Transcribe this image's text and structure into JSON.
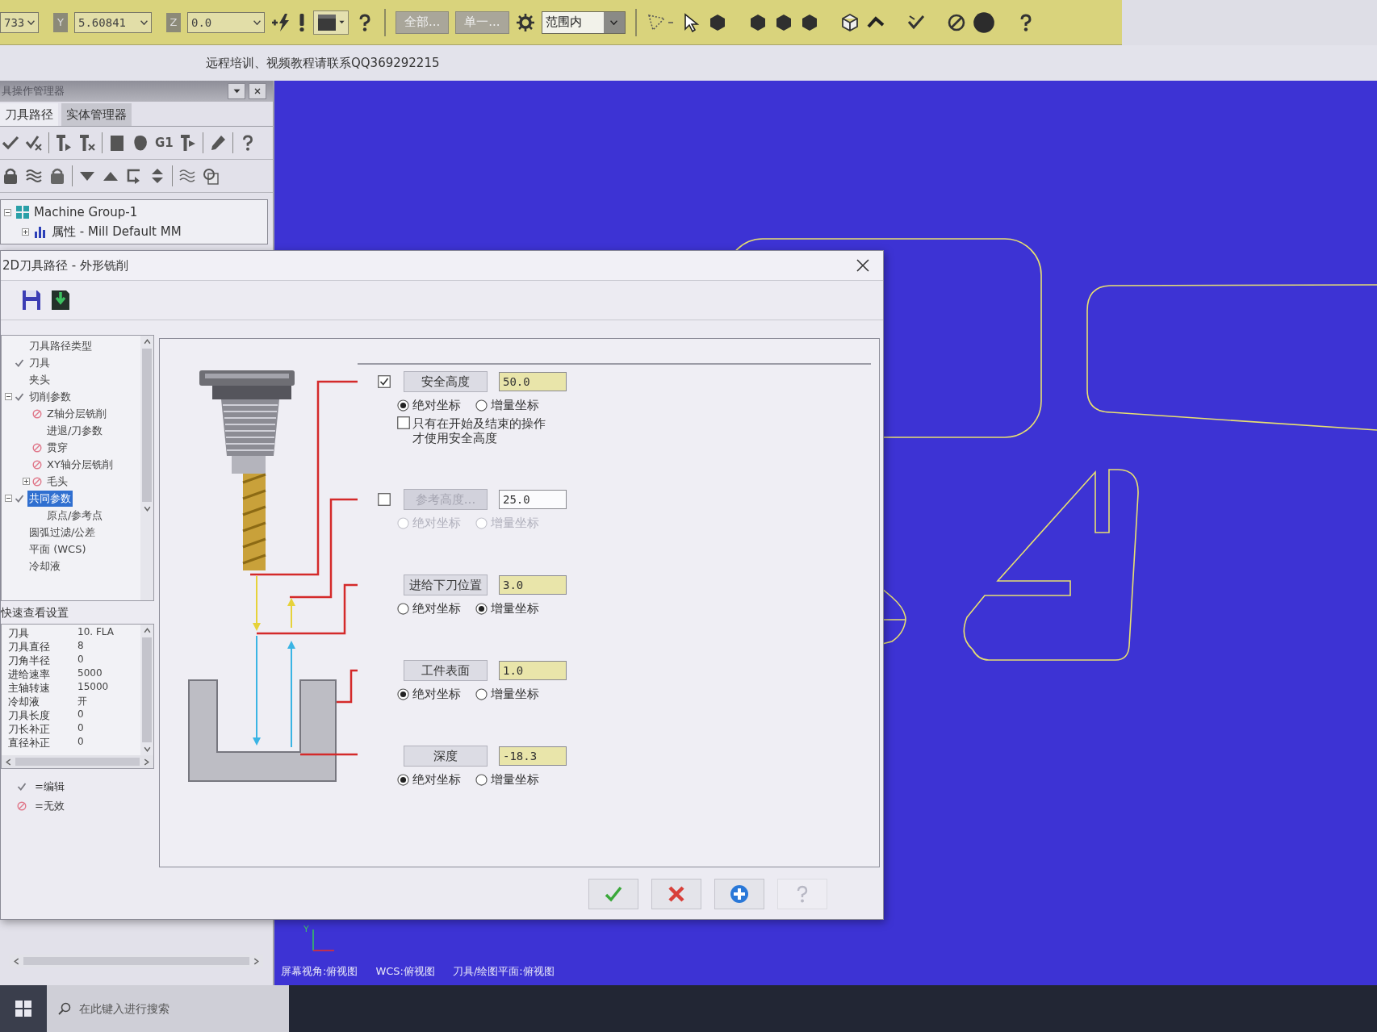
{
  "toolbar": {
    "coord_fields": [
      {
        "value": "733"
      },
      {
        "label": "Y",
        "value": "5.60841"
      },
      {
        "label": "Z",
        "value": "0.0"
      }
    ],
    "select_buttons": [
      "全部...",
      "单一..."
    ],
    "range_dropdown": {
      "value": "范围内"
    }
  },
  "banner": "远程培训、视频教程请联系QQ369292215",
  "manager_panel": {
    "title": "具操作管理器",
    "tabs": [
      {
        "label": "刀具路径",
        "selected": true
      },
      {
        "label": "实体管理器",
        "selected": false
      }
    ],
    "toolbar_text_button": "G1",
    "tree": [
      {
        "kind": "machine_group",
        "label": "Machine Group-1",
        "expanded": true,
        "children": [
          {
            "kind": "properties",
            "label": "属性 - Mill Default MM",
            "expanded": false
          }
        ]
      }
    ]
  },
  "dialog": {
    "title": "2D刀具路径 - 外形铣削",
    "pages": [
      {
        "kind": "plain",
        "label": "刀具路径类型",
        "selected": false
      },
      {
        "kind": "edited",
        "label": "刀具",
        "selected": false
      },
      {
        "kind": "plain",
        "label": "夹头",
        "selected": false
      },
      {
        "kind": "edited",
        "label": "切削参数",
        "expanded": true,
        "selected": false,
        "children": [
          {
            "kind": "invalid",
            "label": "Z轴分层铣削",
            "selected": false
          },
          {
            "kind": "plain",
            "label": "进退/刀参数",
            "selected": false
          },
          {
            "kind": "invalid",
            "label": "贯穿",
            "selected": false
          },
          {
            "kind": "invalid",
            "label": "XY轴分层铣削",
            "selected": false
          },
          {
            "kind": "invalid",
            "label": "毛头",
            "expanded": false,
            "selected": false
          }
        ]
      },
      {
        "kind": "edited",
        "label": "共同参数",
        "expanded": true,
        "selected": true,
        "children": [
          {
            "kind": "plain",
            "label": "原点/参考点",
            "selected": false
          }
        ]
      },
      {
        "kind": "plain",
        "label": "圆弧过滤/公差",
        "selected": false
      },
      {
        "kind": "plain",
        "label": "平面 (WCS)",
        "selected": false
      },
      {
        "kind": "plain",
        "label": "冷却液",
        "selected": false
      }
    ],
    "quick_view": {
      "title": "快速查看设置",
      "rows": [
        {
          "name": "刀具",
          "value": "10. FLA"
        },
        {
          "name": "刀具直径",
          "value": "8"
        },
        {
          "name": "刀角半径",
          "value": "0"
        },
        {
          "name": "进给速率",
          "value": "5000"
        },
        {
          "name": "主轴转速",
          "value": "15000"
        },
        {
          "name": "冷却液",
          "value": "开"
        },
        {
          "name": "刀具长度",
          "value": "0"
        },
        {
          "name": "刀长补正",
          "value": "0"
        },
        {
          "name": "直径补正",
          "value": "0"
        }
      ]
    },
    "legend": [
      {
        "kind": "edited",
        "label": "=编辑"
      },
      {
        "kind": "invalid",
        "label": "=无效"
      }
    ],
    "heights": [
      {
        "label": "安全高度",
        "checked": true,
        "disabled": false,
        "value": "50.0",
        "radios": [
          {
            "label": "绝对坐标",
            "selected": true
          },
          {
            "label": "增量坐标",
            "selected": false
          }
        ],
        "option": {
          "label": "只有在开始及结束的操作才使用安全高度",
          "checked": false
        }
      },
      {
        "label": "参考高度...",
        "checked": false,
        "disabled": true,
        "value": "25.0",
        "radios": [
          {
            "label": "绝对坐标",
            "selected": false
          },
          {
            "label": "增量坐标",
            "selected": false
          }
        ]
      },
      {
        "label": "进给下刀位置",
        "disabled": false,
        "value": "3.0",
        "radios": [
          {
            "label": "绝对坐标",
            "selected": false
          },
          {
            "label": "增量坐标",
            "selected": true
          }
        ]
      },
      {
        "label": "工件表面",
        "disabled": false,
        "value": "1.0",
        "radios": [
          {
            "label": "绝对坐标",
            "selected": true
          },
          {
            "label": "增量坐标",
            "selected": false
          }
        ]
      },
      {
        "label": "深度",
        "disabled": false,
        "value": "-18.3",
        "radios": [
          {
            "label": "绝对坐标",
            "selected": true
          },
          {
            "label": "增量坐标",
            "selected": false
          }
        ]
      }
    ],
    "buttons": [
      {
        "kind": "ok",
        "disabled": false
      },
      {
        "kind": "cancel",
        "disabled": false
      },
      {
        "kind": "add",
        "disabled": false
      },
      {
        "kind": "help",
        "disabled": true
      }
    ]
  },
  "viewport": {
    "axis_label": "Y",
    "view_labels": [
      "屏幕视角:俯视图",
      "WCS:俯视图",
      "刀具/绘图平面:俯视图"
    ]
  },
  "taskbar": {
    "search": {
      "placeholder": "在此键入进行搜索"
    }
  }
}
